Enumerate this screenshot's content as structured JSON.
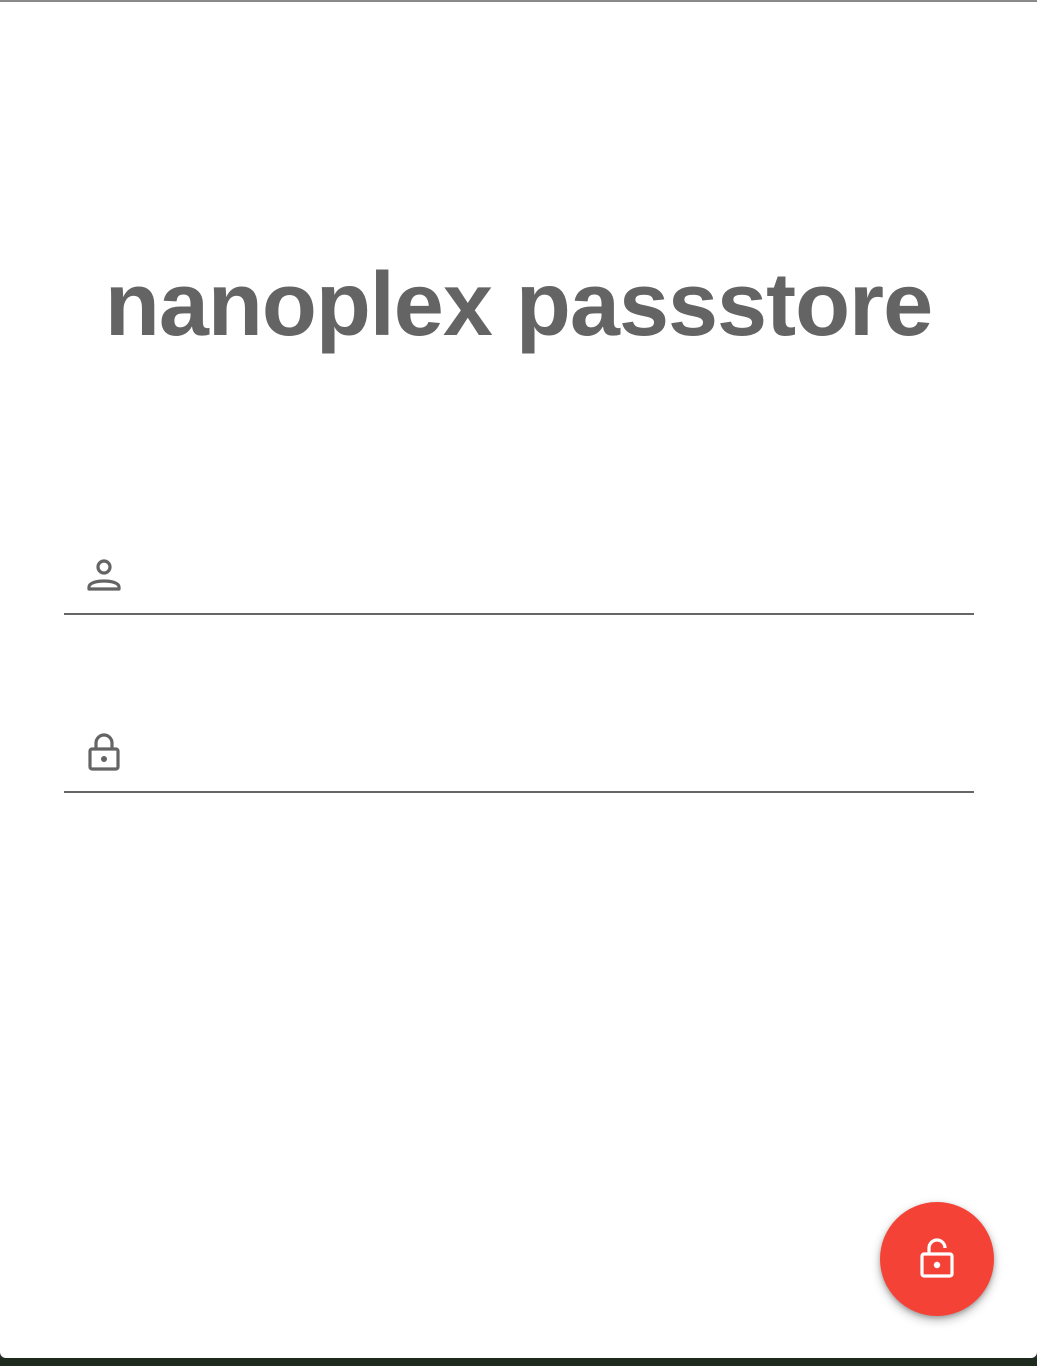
{
  "app": {
    "title": "nanoplex passstore"
  },
  "form": {
    "username": {
      "icon": "person-icon",
      "value": "",
      "placeholder": ""
    },
    "password": {
      "icon": "lock-icon",
      "value": "",
      "placeholder": ""
    }
  },
  "fab": {
    "icon": "unlock-icon",
    "color": "#f44336"
  },
  "colors": {
    "title": "#646464",
    "underline": "#666666",
    "background": "#ffffff"
  }
}
